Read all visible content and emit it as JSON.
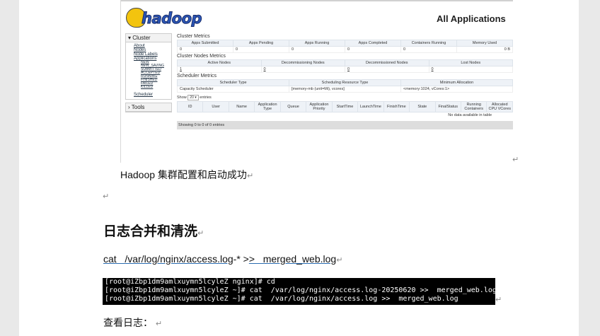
{
  "screenshot": {
    "logo_text": "hadoop",
    "page_title": "All Applications",
    "sidebar": {
      "cluster_label": "Cluster",
      "links": [
        "About",
        "Nodes",
        "Node Labels",
        "Applications"
      ],
      "app_states": [
        "NEW",
        "NEW_SAVING",
        "SUBMITTED",
        "ACCEPTED",
        "RUNNING",
        "FINISHED",
        "FAILED",
        "KILLED"
      ],
      "scheduler_link": "Scheduler",
      "tools_label": "Tools"
    },
    "cluster_metrics": {
      "title": "Cluster Metrics",
      "headers": [
        "Apps Submitted",
        "Apps Pending",
        "Apps Running",
        "Apps Completed",
        "Containers Running",
        "Memory Used"
      ],
      "values": [
        "0",
        "0",
        "0",
        "0",
        "0",
        "0 B"
      ]
    },
    "nodes_metrics": {
      "title": "Cluster Nodes Metrics",
      "headers": [
        "Active Nodes",
        "Decommissioning Nodes",
        "Decommissioned Nodes",
        "Lost Nodes"
      ],
      "values": [
        "1",
        "0",
        "0",
        "0"
      ]
    },
    "scheduler_metrics": {
      "title": "Scheduler Metrics",
      "headers": [
        "Scheduler Type",
        "Scheduling Resource Type",
        "Minimum Allocation"
      ],
      "values": [
        "Capacity Scheduler",
        "[memory-mb (unit=Mi), vcores]",
        "<memory:1024, vCores:1>"
      ]
    },
    "show_entries": {
      "prefix": "Show",
      "count": "20",
      "suffix": "entries"
    },
    "apps_table": {
      "headers": [
        "ID",
        "User",
        "Name",
        "Application Type",
        "Queue",
        "Application Priority",
        "StartTime",
        "LaunchTime",
        "FinishTime",
        "State",
        "FinalStatus",
        "Running Containers",
        "Allocated CPU VCores"
      ],
      "empty_text": "No data available in table"
    },
    "footer_text": "Showing 0 to 0 of 0 entries"
  },
  "return_mark": "↵",
  "caption": "Hadoop 集群配置和启动成功",
  "heading": "日志合并和清洗",
  "command": {
    "part1": "cat   /var/log/nginx/access.log",
    "part2": "-* >",
    "part3": ">   merged_web.log"
  },
  "terminal_lines": [
    "[root@iZbp1dm9amlxuymn5lcyleZ nginx]# cd",
    "[root@iZbp1dm9amlxuymn5lcyleZ ~]# cat  /var/log/nginx/access.log-20250620 >>  merged_web.log",
    "[root@iZbp1dm9amlxuymn5lcyleZ ~]# cat  /var/log/nginx/access.log >>  merged_web.log"
  ],
  "view_log": "查看日志："
}
